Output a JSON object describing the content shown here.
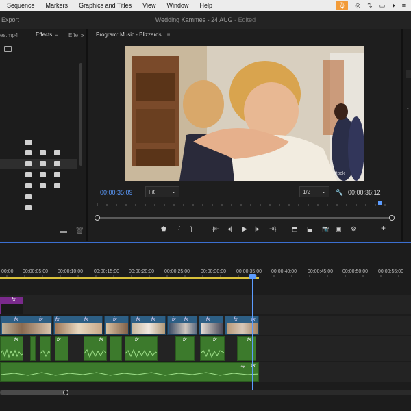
{
  "menubar": {
    "items": [
      "Sequence",
      "Markers",
      "Graphics and Titles",
      "View",
      "Window",
      "Help"
    ]
  },
  "titlebar": {
    "export_label": "Export",
    "title": "Wedding Kammes - 24 AUG",
    "edited": " - Edited"
  },
  "left_panel": {
    "tabs": [
      "es.mp4",
      "Effects",
      "Effe"
    ],
    "active_tab": "Effects",
    "more": "»"
  },
  "program": {
    "tab_title": "Program: Music - Blizzards",
    "current_timecode": "00:00:35:09",
    "fit_label": "Fit",
    "resolution_label": "1/2",
    "duration_timecode": "00:00:36:12",
    "watermark": "stock"
  },
  "timeline": {
    "ticks": [
      "00:00",
      "00:00:05:00",
      "00:00:10:00",
      "00:00:15:00",
      "00:00:20:00",
      "00:00:25:00",
      "00:00:30:00",
      "00:00:35:00",
      "00:00:40:00",
      "00:00:45:00",
      "00:00:50:00",
      "00:00:55:00"
    ],
    "fx_label": "fx"
  },
  "colors": {
    "accent": "#4a8be8",
    "timecode": "#5c9cff",
    "video_clip": "#2d5f85",
    "audio_clip": "#3c7a2c",
    "title_clip": "#7a2a8c",
    "mic": "#f29b38"
  }
}
